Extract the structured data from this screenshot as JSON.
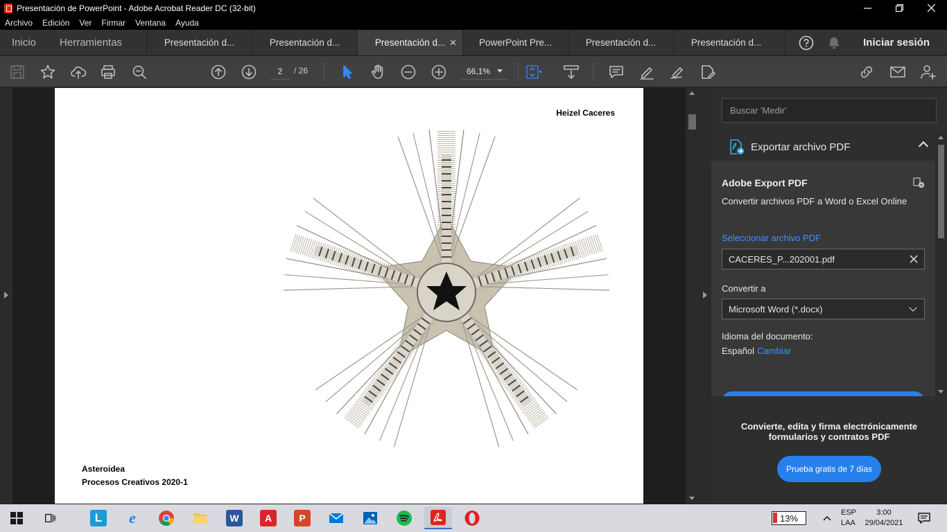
{
  "window": {
    "title": "Presentación de PowerPoint - Adobe Acrobat Reader DC (32-bit)"
  },
  "menu": [
    "Archivo",
    "Edición",
    "Ver",
    "Firmar",
    "Ventana",
    "Ayuda"
  ],
  "tabs": {
    "home": "Inicio",
    "tools": "Herramientas",
    "docs": [
      {
        "label": "Presentación d...",
        "active": false
      },
      {
        "label": "Presentación d...",
        "active": false
      },
      {
        "label": "Presentación d...",
        "active": true
      },
      {
        "label": "PowerPoint Pre...",
        "active": false
      },
      {
        "label": "Presentación d...",
        "active": false
      },
      {
        "label": "Presentación d...",
        "active": false
      }
    ],
    "signin": "Iniciar sesión"
  },
  "toolbar": {
    "page_current": "2",
    "page_total": "/  26",
    "zoom": "66,1%"
  },
  "document": {
    "author": "Heizel Caceres",
    "caption_line1": "Asteroidea",
    "caption_line2": "Procesos Creativos 2020-1"
  },
  "pane": {
    "search_placeholder": "Buscar 'Medir'",
    "export_title": "Exportar archivo PDF",
    "aep_title": "Adobe Export PDF",
    "aep_subtitle": "Convertir archivos PDF a Word o Excel Online",
    "select_link": "Seleccionar archivo PDF",
    "file_name": "CACERES_P...202001.pdf",
    "convert_label": "Convertir a",
    "convert_value": "Microsoft Word (*.docx)",
    "lang_label": "Idioma del documento:",
    "lang_value": "Español",
    "lang_change": "Cambiar",
    "promo_text": "Convierte, edita y firma electrónicamente formularios y contratos PDF",
    "promo_button": "Prueba gratis de 7 días"
  },
  "taskbar": {
    "battery": "13%",
    "lang_line1": "ESP",
    "lang_line2": "LAA",
    "time": "3:00",
    "date": "29/04/2021"
  },
  "colors": {
    "accent_blue": "#2680eb",
    "link_blue": "#3a96ff",
    "acrobat_red": "#e2231a"
  }
}
